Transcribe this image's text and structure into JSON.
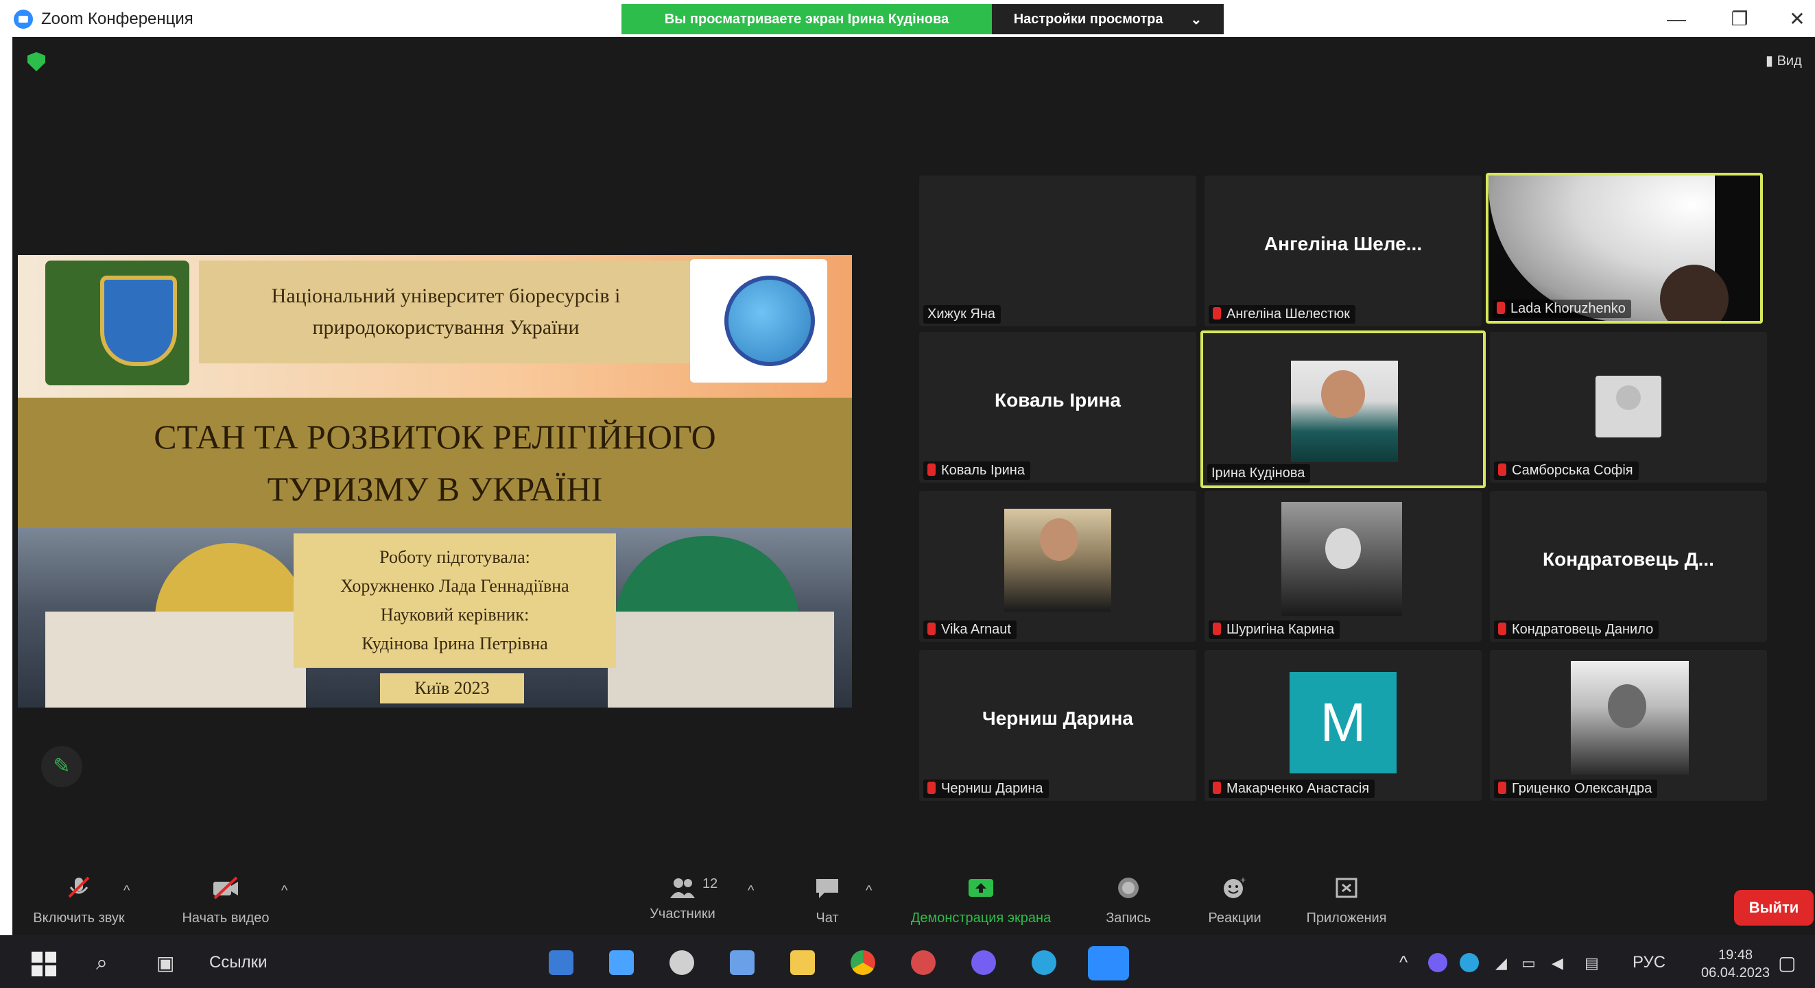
{
  "window": {
    "title": "Zoom Конференция",
    "minimize": "—",
    "restore": "❐",
    "close": "✕"
  },
  "share_banner": {
    "text": "Вы просматриваете экран Ірина Кудінова",
    "view_options": "Настройки просмотра",
    "view_options_caret": "⌄"
  },
  "view_toggle": "Вид",
  "slide": {
    "university": [
      "Національний університет біоресурсів і",
      "природокористування України"
    ],
    "title": [
      "СТАН ТА РОЗВИТОК РЕЛІГІЙНОГО",
      "ТУРИЗМУ В УКРАЇНІ"
    ],
    "authors": [
      "Роботу підготувала:",
      "Хоружненко Лада Геннадіївна",
      "Науковий керівник:",
      "Кудінова Ірина Петрівна"
    ],
    "city_year": "Київ 2023"
  },
  "participants": [
    {
      "display": "",
      "label": "Хижук Яна",
      "muted": false,
      "active": false,
      "avatar": "none"
    },
    {
      "display": "Ангеліна Шеле...",
      "label": "Ангеліна Шелестюк",
      "muted": true,
      "active": false,
      "avatar": "none"
    },
    {
      "display": "",
      "label": "Lada Khoruzhenko",
      "muted": true,
      "active": true,
      "avatar": "video"
    },
    {
      "display": "Коваль Ірина",
      "label": "Коваль Ірина",
      "muted": true,
      "active": false,
      "avatar": "none"
    },
    {
      "display": "",
      "label": "Ірина Кудінова",
      "muted": false,
      "active": true,
      "avatar": "photo"
    },
    {
      "display": "",
      "label": "Самборська Софія",
      "muted": true,
      "active": false,
      "avatar": "default"
    },
    {
      "display": "",
      "label": "Vika Arnaut",
      "muted": true,
      "active": false,
      "avatar": "photo"
    },
    {
      "display": "",
      "label": "Шуригіна Карина",
      "muted": true,
      "active": false,
      "avatar": "photo-bw"
    },
    {
      "display": "Кондратовець Д...",
      "label": "Кондратовець Данило",
      "muted": true,
      "active": false,
      "avatar": "none"
    },
    {
      "display": "Черниш Дарина",
      "label": "Черниш Дарина",
      "muted": true,
      "active": false,
      "avatar": "none"
    },
    {
      "display": "",
      "label": "Макарченко Анастасія",
      "muted": true,
      "active": false,
      "avatar": "letter",
      "letter": "M"
    },
    {
      "display": "",
      "label": "Гриценко Олександра",
      "muted": true,
      "active": false,
      "avatar": "photo-bw"
    }
  ],
  "toolbar": {
    "unmute": "Включить звук",
    "start_video": "Начать видео",
    "participants": "Участники",
    "participants_count": "12",
    "chat": "Чат",
    "share_screen": "Демонстрация экрана",
    "record": "Запись",
    "reactions": "Реакции",
    "apps": "Приложения",
    "leave": "Выйти",
    "caret": "^"
  },
  "taskbar": {
    "search_label": "Ссылки",
    "language": "РУС",
    "time": "19:48",
    "date": "06.04.2023"
  },
  "colors": {
    "green": "#2dbd4a",
    "active_border": "#d6e85a",
    "leave": "#e02828",
    "muted": "#e02828"
  }
}
